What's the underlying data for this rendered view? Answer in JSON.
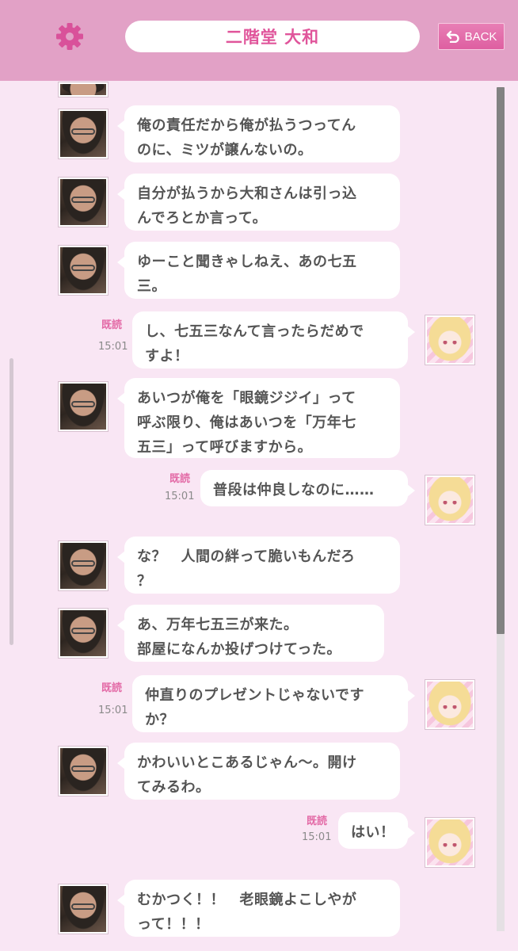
{
  "header": {
    "title": "二階堂 大和",
    "back_label": "BACK",
    "settings_icon": "gear-icon",
    "back_icon": "return-arrow-icon"
  },
  "colors": {
    "header_bg": "#e2a1c6",
    "title_text": "#e0559b",
    "back_button": "#de5fa1",
    "chat_bg": "#f9e6f4",
    "read_label": "#e36aa6"
  },
  "messages": [
    {
      "sender": "yamato",
      "text": "俺の責任だから俺が払うつってん\nのに、ミツが譲んないの。"
    },
    {
      "sender": "yamato",
      "text": "自分が払うから大和さんは引っ込\nんでろとか言って。"
    },
    {
      "sender": "yamato",
      "text": "ゆーこと聞きゃしねえ、あの七五\n三。"
    },
    {
      "sender": "me",
      "text": "し、七五三なんて言ったらだめで\nすよ！",
      "read": "既読",
      "time": "15:01"
    },
    {
      "sender": "yamato",
      "text": "あいつが俺を「眼鏡ジジイ」って\n呼ぶ限り、俺はあいつを「万年七\n五三」って呼びますから。"
    },
    {
      "sender": "me",
      "text": "普段は仲良しなのに……",
      "read": "既読",
      "time": "15:01"
    },
    {
      "sender": "yamato",
      "text": "な？　人間の絆って脆いもんだろ\n？"
    },
    {
      "sender": "yamato",
      "text": "あ、万年七五三が来た。\n部屋になんか投げつけてった。"
    },
    {
      "sender": "me",
      "text": "仲直りのプレゼントじゃないです\nか？",
      "read": "既読",
      "time": "15:01"
    },
    {
      "sender": "yamato",
      "text": "かわいいとこあるじゃん〜。開け\nてみるわ。"
    },
    {
      "sender": "me",
      "text": "はい！",
      "read": "既読",
      "time": "15:01"
    },
    {
      "sender": "yamato",
      "text": "むかつく！！　老眼鏡よこしやが\nって！！！"
    }
  ]
}
